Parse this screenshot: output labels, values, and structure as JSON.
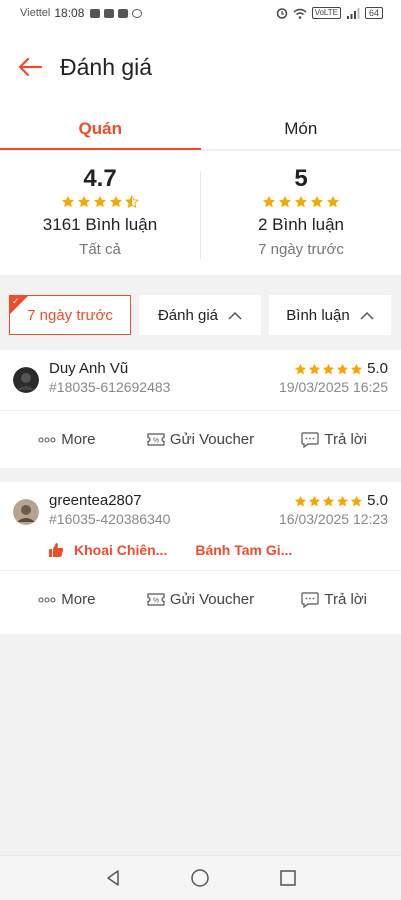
{
  "status_bar": {
    "carrier": "Viettel",
    "time": "18:08",
    "app_icons": [
      "Zalo",
      "Zalo",
      "Zalo"
    ],
    "network": "VoLTE",
    "battery": "64"
  },
  "header": {
    "title": "Đánh giá"
  },
  "tabs": [
    {
      "label": "Quán",
      "active": true
    },
    {
      "label": "Món",
      "active": false
    }
  ],
  "summary": {
    "all": {
      "score": "4.7",
      "count_text": "3161 Bình luận",
      "label": "Tất cả",
      "stars": 4.5
    },
    "recent": {
      "score": "5",
      "count_text": "2 Bình luận",
      "label": "7 ngày trước",
      "stars": 5
    }
  },
  "filters": [
    {
      "label": "7 ngày trước",
      "selected": true
    },
    {
      "label": "Đánh giá",
      "selected": false
    },
    {
      "label": "Bình luận",
      "selected": false
    }
  ],
  "reviews": [
    {
      "name": "Duy Anh Vũ",
      "order_id": "#18035-612692483",
      "rating": "5.0",
      "stars": 5,
      "date": "19/03/2025 16:25",
      "liked_dishes": []
    },
    {
      "name": "greentea2807",
      "order_id": "#16035-420386340",
      "rating": "5.0",
      "stars": 5,
      "date": "16/03/2025 12:23",
      "liked_dishes": [
        "Khoai Chiên...",
        "Bánh Tam Gi..."
      ]
    }
  ],
  "actions": {
    "more": "More",
    "voucher": "Gửi Voucher",
    "reply": "Trả lời"
  },
  "colors": {
    "accent": "#ee4d2d",
    "star": "#f6a700",
    "background": "#f2f2f2"
  }
}
